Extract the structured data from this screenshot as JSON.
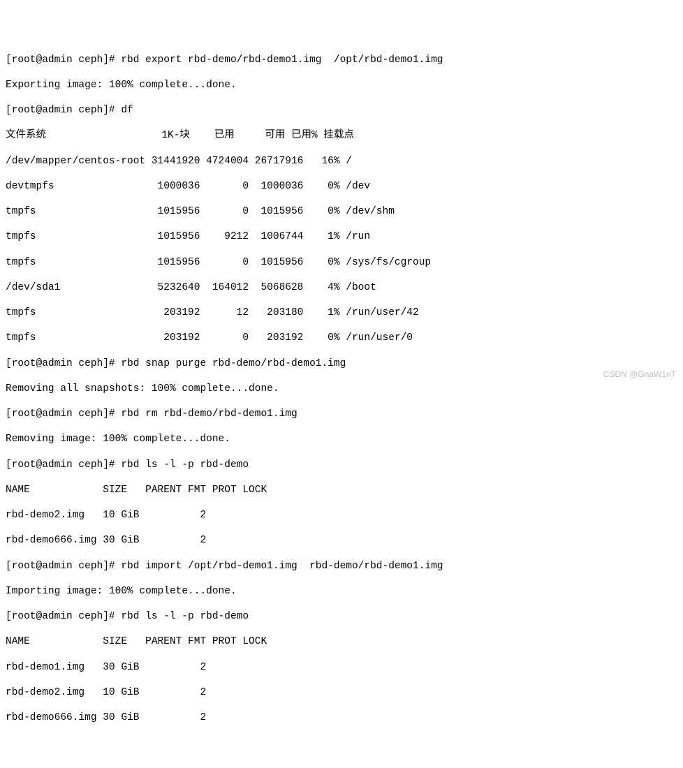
{
  "prompt1": "[root@admin ceph]# rbd export rbd-demo/rbd-demo1.img  /opt/rbd-demo1.img",
  "export_msg": "Exporting image: 100% complete...done.",
  "prompt2": "[root@admin ceph]# df",
  "df": {
    "header": "文件系统                   1K-块    已用     可用 已用% 挂载点",
    "rows": [
      "/dev/mapper/centos-root 31441920 4724004 26717916   16% /",
      "devtmpfs                 1000036       0  1000036    0% /dev",
      "tmpfs                    1015956       0  1015956    0% /dev/shm",
      "tmpfs                    1015956    9212  1006744    1% /run",
      "tmpfs                    1015956       0  1015956    0% /sys/fs/cgroup",
      "/dev/sda1                5232640  164012  5068628    4% /boot",
      "tmpfs                     203192      12   203180    1% /run/user/42",
      "tmpfs                     203192       0   203192    0% /run/user/0"
    ]
  },
  "prompt3": "[root@admin ceph]# rbd snap purge rbd-demo/rbd-demo1.img",
  "purge_msg": "Removing all snapshots: 100% complete...done.",
  "prompt4": "[root@admin ceph]# rbd rm rbd-demo/rbd-demo1.img",
  "rm_msg": "Removing image: 100% complete...done.",
  "prompt5": "[root@admin ceph]# rbd ls -l -p rbd-demo",
  "ls1": {
    "header": "NAME            SIZE   PARENT FMT PROT LOCK ",
    "rows": [
      "rbd-demo2.img   10 GiB          2           ",
      "rbd-demo666.img 30 GiB          2           "
    ]
  },
  "prompt6": "[root@admin ceph]# rbd import /opt/rbd-demo1.img  rbd-demo/rbd-demo1.img",
  "import_msg": "Importing image: 100% complete...done.",
  "prompt7": "[root@admin ceph]# rbd ls -l -p rbd-demo",
  "ls2": {
    "header": "NAME            SIZE   PARENT FMT PROT LOCK ",
    "rows": [
      "rbd-demo1.img   30 GiB          2           ",
      "rbd-demo2.img   10 GiB          2           ",
      "rbd-demo666.img 30 GiB          2           "
    ]
  },
  "watermark": "CSDN @GnaW1nT"
}
